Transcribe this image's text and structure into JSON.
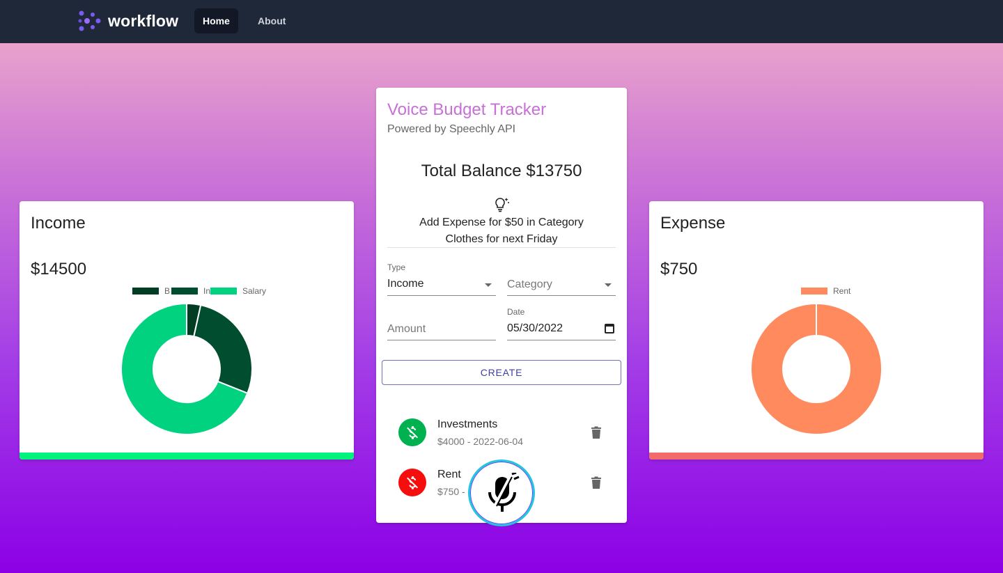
{
  "nav": {
    "brand": "workflow",
    "links": [
      {
        "label": "Home",
        "active": true
      },
      {
        "label": "About",
        "active": false
      }
    ]
  },
  "income": {
    "title": "Income",
    "amount": "$14500",
    "accent": "#00f47c"
  },
  "expense": {
    "title": "Expense",
    "amount": "$750",
    "accent": "#f26a6a"
  },
  "main": {
    "title": "Voice Budget Tracker",
    "subtitle": "Powered by Speechly API",
    "balance": "Total Balance $13750",
    "hint_line1": "Add Expense for $50 in Category",
    "hint_line2": "Clothes for next Friday",
    "form": {
      "type_label": "Type",
      "type_value": "Income",
      "category_placeholder": "Category",
      "amount_placeholder": "Amount",
      "date_label": "Date",
      "date_value": "05/30/2022",
      "create_label": "CREATE"
    },
    "transactions": [
      {
        "name": "Investments",
        "sub": "$4000 - 2022-06-04",
        "color": "#00b14f",
        "kind": "income"
      },
      {
        "name": "Rent",
        "sub": "$750 -",
        "color": "#f60d0d",
        "kind": "expense"
      }
    ]
  },
  "chart_data": [
    {
      "type": "pie",
      "title": "",
      "categories": [
        "B",
        "In",
        "Salary"
      ],
      "values": [
        500,
        4000,
        10000
      ],
      "colors": [
        "#003d23",
        "#004d30",
        "#00d27f"
      ],
      "legend": "top"
    },
    {
      "type": "pie",
      "title": "",
      "categories": [
        "Rent"
      ],
      "values": [
        750
      ],
      "colors": [
        "#fe8a5e"
      ],
      "legend": "top"
    }
  ]
}
